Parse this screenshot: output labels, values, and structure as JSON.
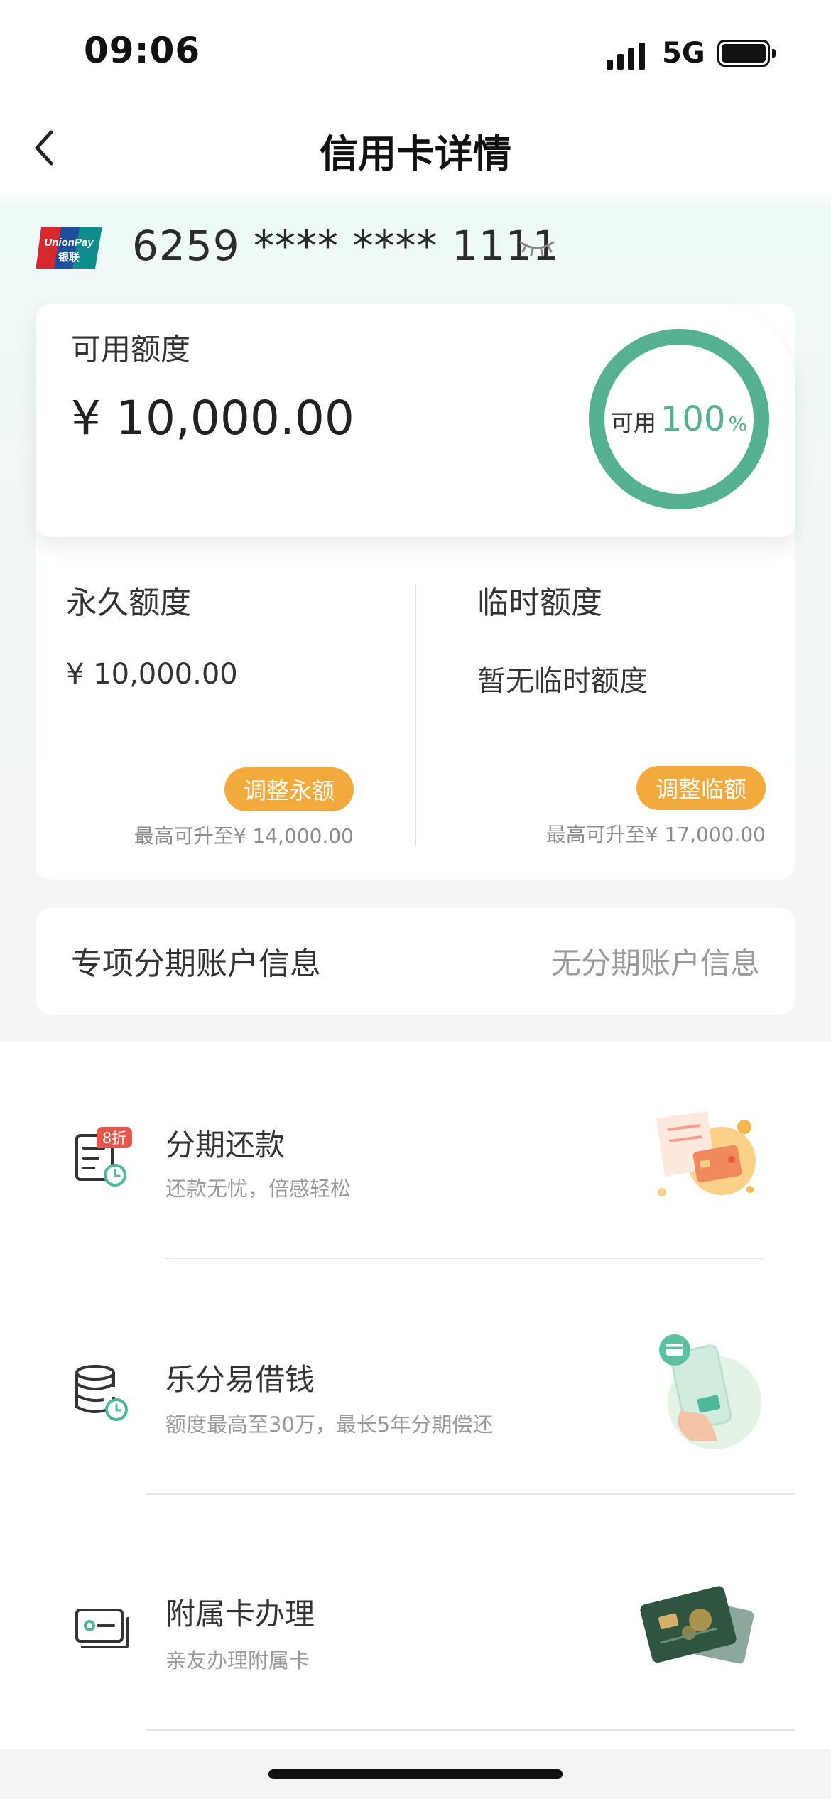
{
  "status_bar": {
    "time": "09:06",
    "network": "5G"
  },
  "header": {
    "title": "信用卡详情"
  },
  "card": {
    "number": "6259 **** **** 1111",
    "brand_top": "UnionPay",
    "brand_bottom": "银联"
  },
  "available": {
    "label": "可用额度",
    "amount": "¥ 10,000.00",
    "ring_prefix": "可用",
    "ring_percent": "100",
    "ring_unit": "%",
    "ring_fraction": 1.0
  },
  "permanent": {
    "label": "永久额度",
    "amount": "¥ 10,000.00",
    "button": "调整永额",
    "max_note": "最高可升至¥ 14,000.00"
  },
  "temporary": {
    "label": "临时额度",
    "amount": "暂无临时额度",
    "button": "调整临额",
    "max_note": "最高可升至¥ 17,000.00"
  },
  "installment_account": {
    "label": "专项分期账户信息",
    "value": "无分期账户信息"
  },
  "services": [
    {
      "title": "分期还款",
      "desc": "还款无忧，倍感轻松",
      "badge": "8折",
      "icon": "bill-clock-icon"
    },
    {
      "title": "乐分易借钱",
      "desc": "额度最高至30万，最长5年分期偿还",
      "icon": "coins-clock-icon"
    },
    {
      "title": "附属卡办理",
      "desc": "亲友办理附属卡",
      "icon": "card-icon"
    }
  ],
  "colors": {
    "accent_green": "#55b191",
    "button_orange": "#f3aa3c",
    "muted_text": "#9a9a9a"
  }
}
